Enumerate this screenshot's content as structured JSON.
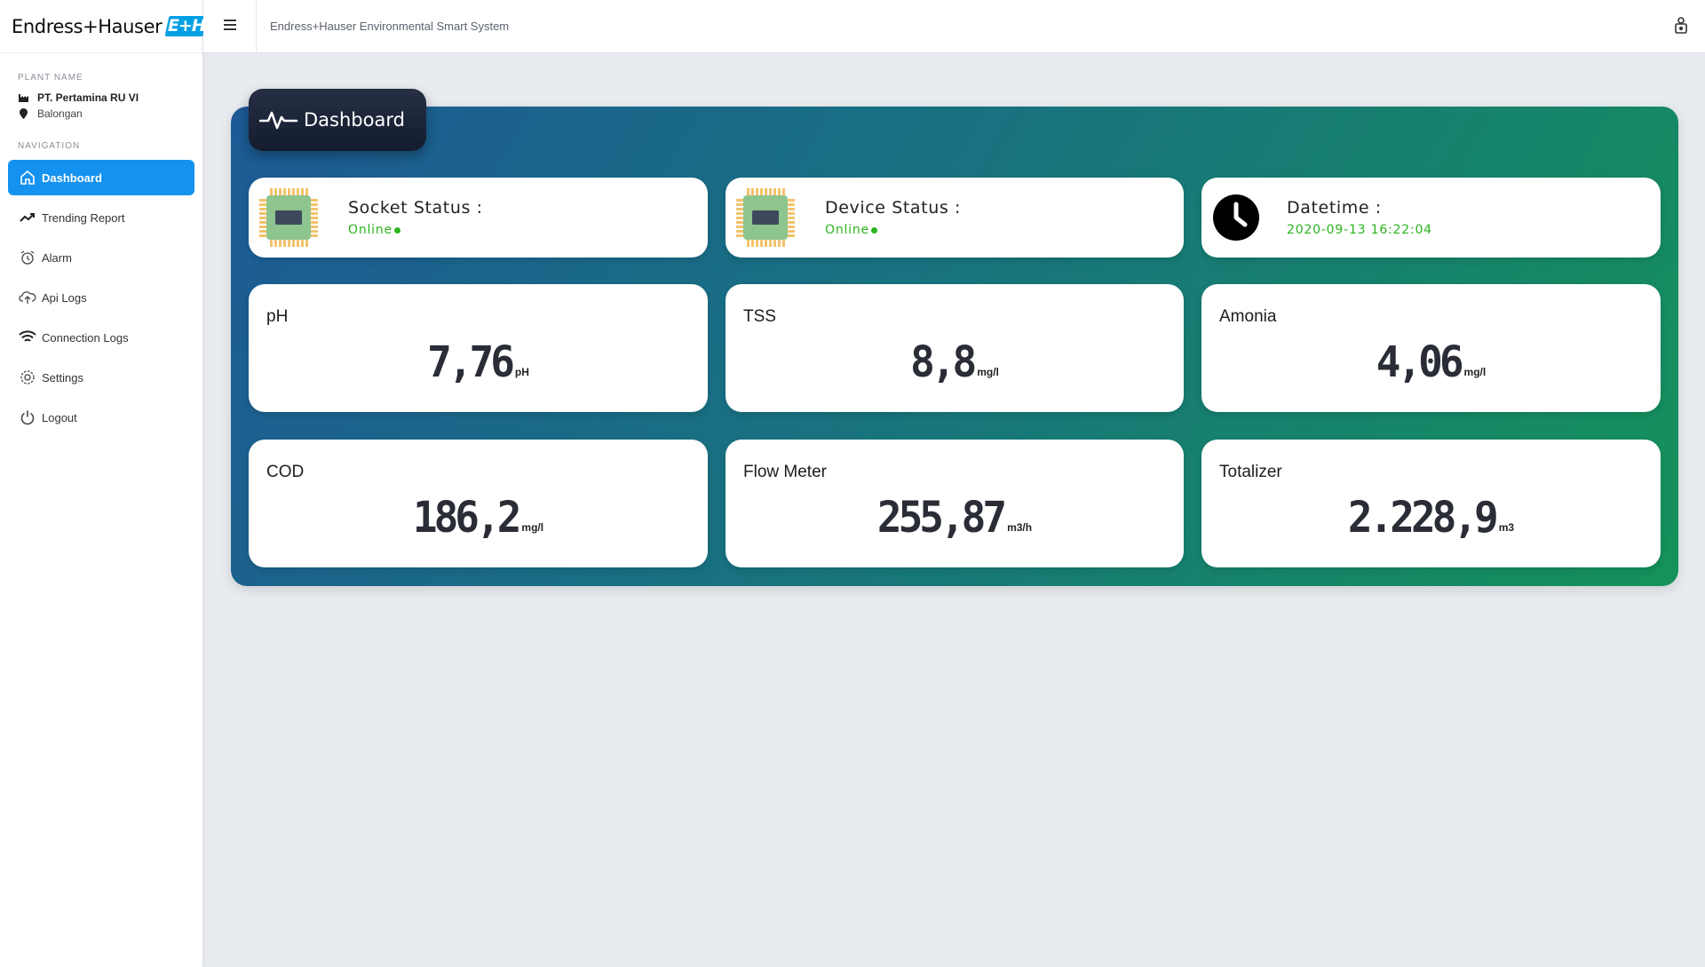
{
  "brand": {
    "name": "Endress+Hauser",
    "logo_text": "E+H"
  },
  "app_title": "Endress+Hauser Environmental Smart System",
  "plant": {
    "section_label": "PLANT NAME",
    "name": "PT. Pertamina RU VI",
    "location": "Balongan"
  },
  "navigation": {
    "section_label": "NAVIGATION",
    "items": [
      {
        "label": "Dashboard",
        "icon": "home-icon",
        "active": true
      },
      {
        "label": "Trending Report",
        "icon": "trending-up-icon",
        "active": false
      },
      {
        "label": "Alarm",
        "icon": "alarm-clock-icon",
        "active": false
      },
      {
        "label": "Api Logs",
        "icon": "cloud-upload-icon",
        "active": false
      },
      {
        "label": "Connection Logs",
        "icon": "wifi-icon",
        "active": false
      },
      {
        "label": "Settings",
        "icon": "gear-icon",
        "active": false
      },
      {
        "label": "Logout",
        "icon": "power-icon",
        "active": false
      }
    ]
  },
  "panel": {
    "title": "Dashboard",
    "icon": "heartbeat-icon"
  },
  "status": {
    "socket": {
      "label": "Socket Status :",
      "value": "Online"
    },
    "device": {
      "label": "Device Status :",
      "value": "Online"
    },
    "datetime": {
      "label": "Datetime :",
      "value": "2020-09-13 16:22:04"
    }
  },
  "metrics": [
    {
      "label": "pH",
      "value": "7,76",
      "unit": "pH"
    },
    {
      "label": "TSS",
      "value": "8,8",
      "unit": "mg/l"
    },
    {
      "label": "Amonia",
      "value": "4,06",
      "unit": "mg/l"
    },
    {
      "label": "COD",
      "value": "186,2",
      "unit": "mg/l"
    },
    {
      "label": "Flow Meter",
      "value": "255,87",
      "unit": "m3/h"
    },
    {
      "label": "Totalizer",
      "value": "2.228,9",
      "unit": "m3"
    }
  ],
  "colors": {
    "accent": "#1592f0",
    "online": "#2ab41e",
    "panel_gradient_start": "#1d5a96",
    "panel_gradient_end": "#15925a"
  }
}
